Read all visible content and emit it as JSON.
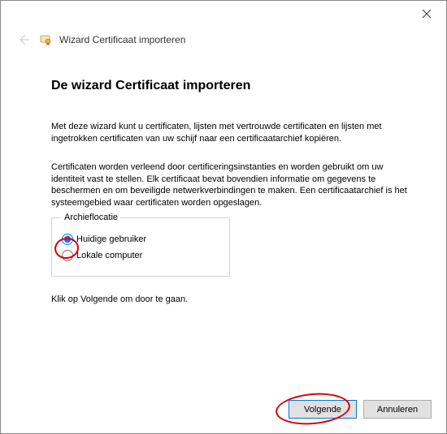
{
  "header": {
    "title": "Wizard Certificaat importeren"
  },
  "main": {
    "heading": "De wizard Certificaat importeren",
    "description": "Met deze wizard kunt u certificaten, lijsten met vertrouwde certificaten en lijsten met ingetrokken certificaten van uw schijf naar een certificaatarchief kopiëren.",
    "info": "Certificaten worden verleend door certificeringsinstanties en worden gebruikt om uw identiteit vast te stellen. Elk certificaat bevat bovendien informatie om gegevens te beschermen en om beveiligde netwerkverbindingen te maken. Een certificaatarchief is het systeemgebied waar certificaten worden opgeslagen.",
    "fieldset_legend": "Archieflocatie",
    "radio_current_user": "Huidige gebruiker",
    "radio_local_computer": "Lokale computer",
    "continue_hint": "Klik op Volgende om door te gaan."
  },
  "buttons": {
    "next": "Volgende",
    "cancel": "Annuleren"
  }
}
